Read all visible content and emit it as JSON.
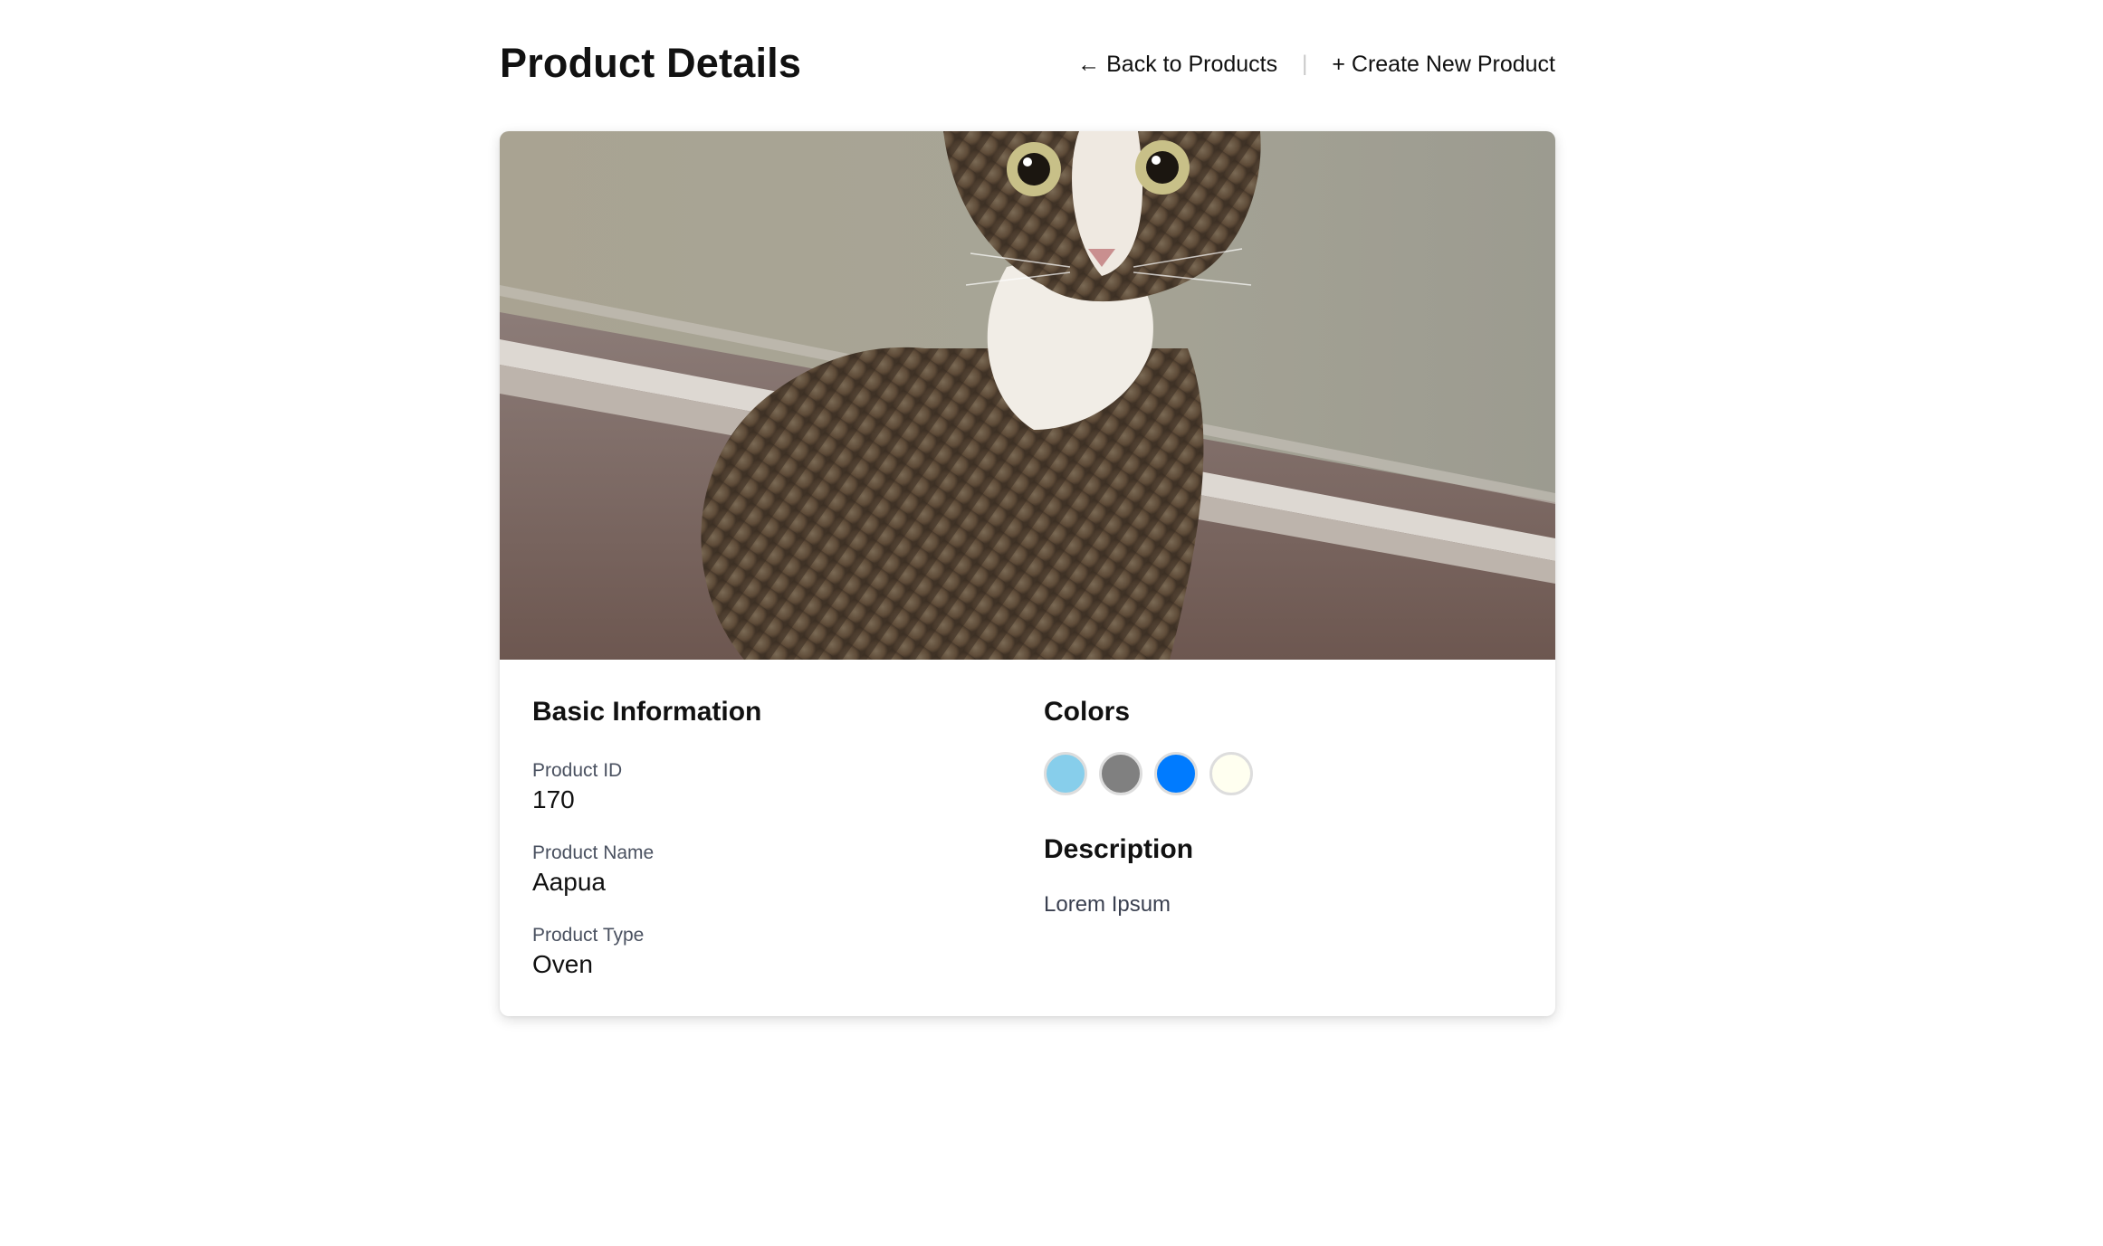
{
  "header": {
    "title": "Product Details",
    "back_link": "← Back to Products",
    "separator": "|",
    "create_link": "+ Create New Product"
  },
  "image": {
    "description_icon": "product-photo"
  },
  "basic_info": {
    "title": "Basic Information",
    "fields": [
      {
        "label": "Product ID",
        "value": "170"
      },
      {
        "label": "Product Name",
        "value": "Aapua"
      },
      {
        "label": "Product Type",
        "value": "Oven"
      }
    ]
  },
  "colors": {
    "title": "Colors",
    "swatches": [
      "#87ceeb",
      "#808080",
      "#007bff",
      "#fffff0"
    ]
  },
  "description": {
    "title": "Description",
    "text": "Lorem Ipsum"
  }
}
